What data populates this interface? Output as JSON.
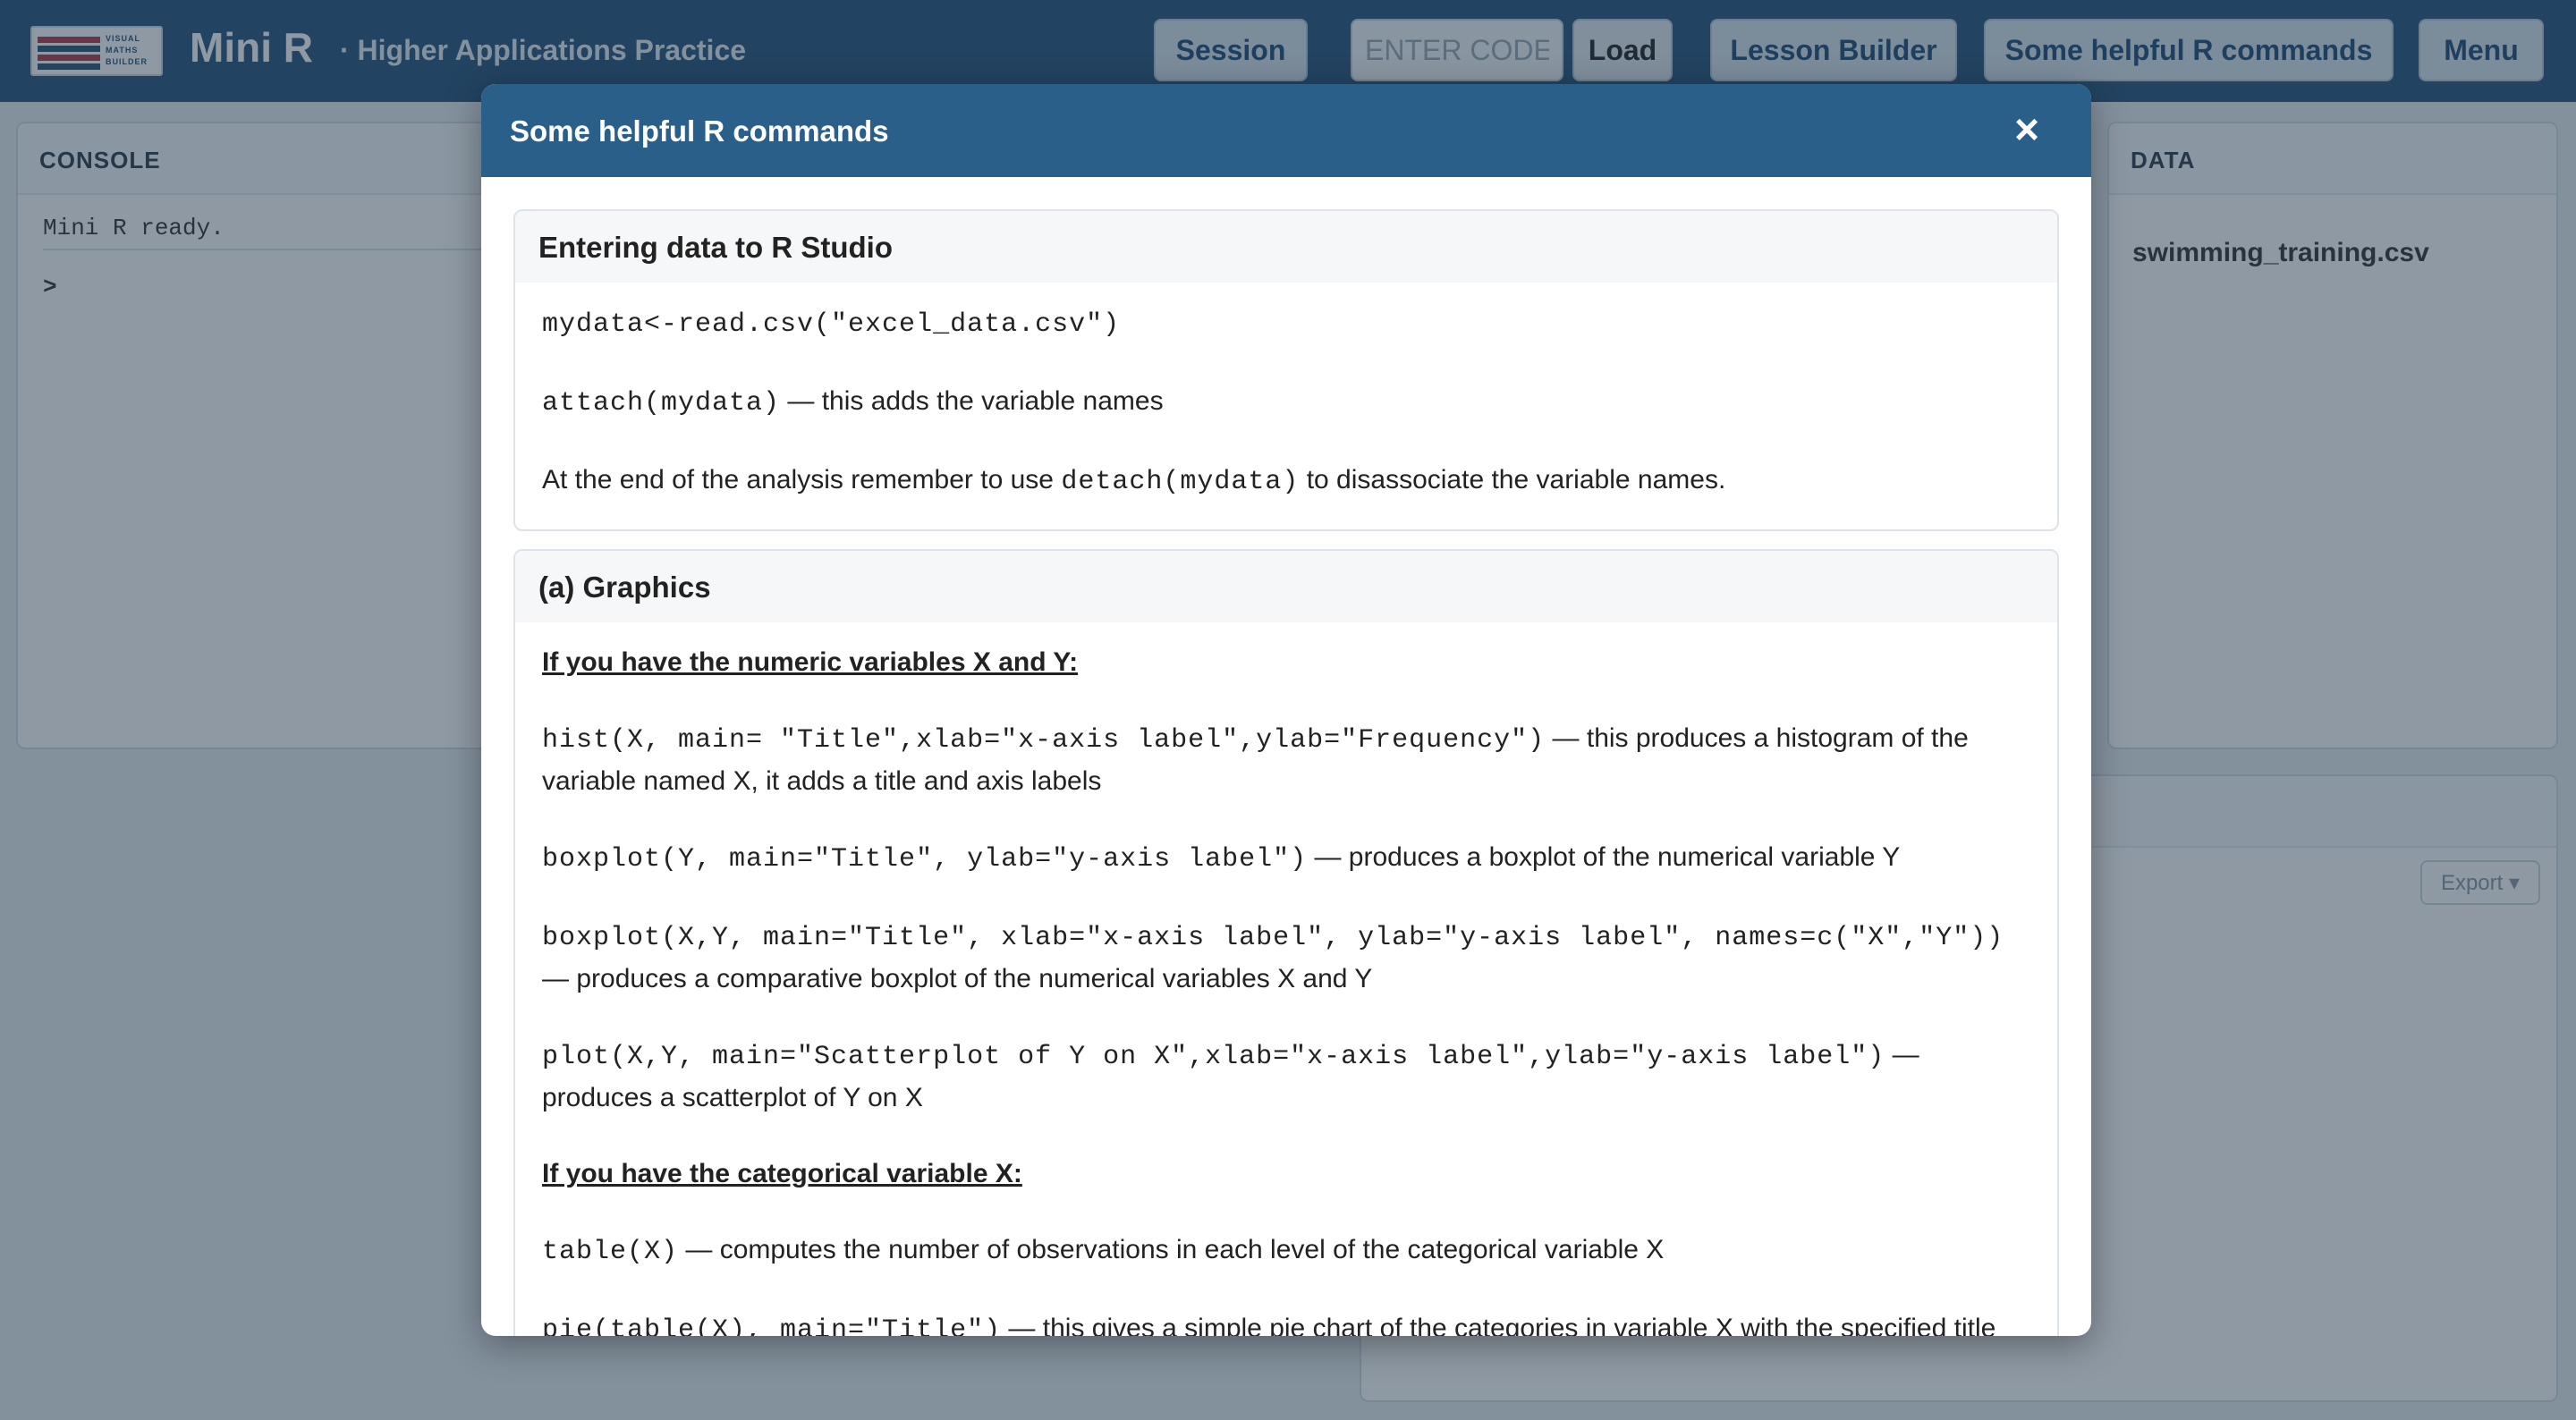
{
  "topbar": {
    "logo_text": [
      "VISUAL",
      "MATHS",
      "BUILDER"
    ],
    "app_title": "Mini R",
    "app_subtitle": "· Higher Applications Practice",
    "session_label": "Session",
    "code_placeholder": "ENTER CODE",
    "load_label": "Load",
    "lesson_builder_label": "Lesson Builder",
    "helpful_label": "Some helpful R commands",
    "menu_label": "Menu"
  },
  "console": {
    "header": "CONSOLE",
    "ready_text": "Mini R ready.",
    "prompt": ">"
  },
  "data_panel": {
    "header": "DATA",
    "dataset": "swimming_training.csv"
  },
  "export_label": "Export ▾",
  "modal": {
    "title": "Some helpful R commands",
    "close": "×",
    "entering": {
      "header": "Entering data to R Studio",
      "read_code": "mydata<-read.csv(\"excel_data.csv\")",
      "attach_code": "attach(mydata)",
      "attach_desc": " — this adds the variable names",
      "detach_pre": "At the end of the analysis remember to use ",
      "detach_code": "detach(mydata)",
      "detach_post": " to disassociate the variable names."
    },
    "graphics": {
      "header": "(a) Graphics",
      "numeric_heading": "If you have the numeric variables X and Y:",
      "hist_code": "hist(X, main= \"Title\",xlab=\"x-axis label\",ylab=\"Frequency\")",
      "hist_desc": " — this produces a histogram of the variable named X, it adds a title and axis labels",
      "box1_code": "boxplot(Y, main=\"Title\", ylab=\"y-axis label\")",
      "box1_desc": " — produces a boxplot of the numerical variable Y",
      "box2_code": "boxplot(X,Y, main=\"Title\", xlab=\"x-axis label\", ylab=\"y-axis label\", names=c(\"X\",\"Y\"))",
      "box2_desc": " — produces a comparative boxplot of the numerical variables X and Y",
      "plot_code": "plot(X,Y, main=\"Scatterplot of Y on X\",xlab=\"x-axis label\",ylab=\"y-axis label\")",
      "plot_desc": " — produces a scatterplot of Y on X",
      "categorical_heading": "If you have the categorical variable X:",
      "table_code": "table(X)",
      "table_desc": " — computes the number of observations in each level of the categorical variable X",
      "pie_code": "pie(table(X), main=\"Title\")",
      "pie_desc": " — this gives a simple pie chart of the categories in variable X with the specified title"
    }
  }
}
